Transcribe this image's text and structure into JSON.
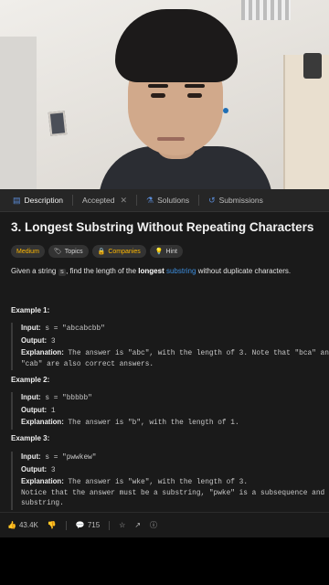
{
  "tabs": [
    {
      "label": "Description",
      "icon": "document-icon"
    },
    {
      "label": "Accepted",
      "icon": "none"
    },
    {
      "label": "Solutions",
      "icon": "flask-icon"
    },
    {
      "label": "Submissions",
      "icon": "history-icon"
    }
  ],
  "problem": {
    "title": "3. Longest Substring Without Repeating Characters",
    "tags": {
      "difficulty": "Medium",
      "topics": "Topics",
      "companies": "Companies",
      "hint": "Hint"
    },
    "desc_pre": "Given a string",
    "desc_var": "s",
    "desc_mid": ", find the length of the",
    "desc_bold": "longest",
    "desc_link": "substring",
    "desc_post": "without duplicate characters."
  },
  "examples": [
    {
      "heading": "Example 1:",
      "input": "s = \"abcabcbb\"",
      "output": "3",
      "explanation_line1": "The answer is \"abc\", with the length of 3. Note that \"bca\" and",
      "explanation_line2": "\"cab\" are also correct answers."
    },
    {
      "heading": "Example 2:",
      "input": "s = \"bbbbb\"",
      "output": "1",
      "explanation_line1": "The answer is \"b\", with the length of 1."
    },
    {
      "heading": "Example 3:",
      "input": "s = \"pwwkew\"",
      "output": "3",
      "explanation_line1": "The answer is \"wke\", with the length of 3.",
      "explanation_line2": "Notice that the answer must be a substring, \"pwke\" is a subsequence and not a",
      "explanation_line3": "substring."
    }
  ],
  "labels": {
    "input": "Input:",
    "output": "Output:",
    "explanation": "Explanation:"
  },
  "footer": {
    "likes": "43.4K",
    "comments": "715"
  },
  "colors": {
    "medium": "#ffb800",
    "link": "#3d8fe0",
    "panel_bg": "#1a1a1a"
  }
}
